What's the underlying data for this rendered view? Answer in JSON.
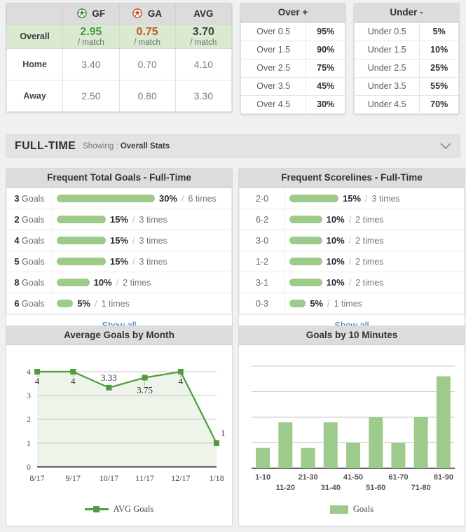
{
  "goals_table": {
    "columns": [
      {
        "label": "",
        "icon": ""
      },
      {
        "label": "GF",
        "icon": "football-green-icon"
      },
      {
        "label": "GA",
        "icon": "football-red-icon"
      },
      {
        "label": "AVG",
        "icon": ""
      }
    ],
    "rows": [
      {
        "label": "Overall",
        "gf": "2.95",
        "gf_sub": "/ match",
        "ga": "0.75",
        "ga_sub": "/ match",
        "avg": "3.70",
        "avg_sub": "/ match"
      },
      {
        "label": "Home",
        "gf": "3.40",
        "ga": "0.70",
        "avg": "4.10"
      },
      {
        "label": "Away",
        "gf": "2.50",
        "ga": "0.80",
        "avg": "3.30"
      }
    ]
  },
  "over": {
    "title": "Over +",
    "rows": [
      {
        "label": "Over 0.5",
        "pct": "95%"
      },
      {
        "label": "Over 1.5",
        "pct": "90%"
      },
      {
        "label": "Over 2.5",
        "pct": "75%"
      },
      {
        "label": "Over 3.5",
        "pct": "45%"
      },
      {
        "label": "Over 4.5",
        "pct": "30%"
      }
    ]
  },
  "under": {
    "title": "Under -",
    "rows": [
      {
        "label": "Under 0.5",
        "pct": "5%"
      },
      {
        "label": "Under 1.5",
        "pct": "10%"
      },
      {
        "label": "Under 2.5",
        "pct": "25%"
      },
      {
        "label": "Under 3.5",
        "pct": "55%"
      },
      {
        "label": "Under 4.5",
        "pct": "70%"
      }
    ]
  },
  "fulltime_bar": {
    "title": "FULL-TIME",
    "showing_label": "Showing :",
    "showing_value": "Overall Stats",
    "chevron": "chevron-down-icon"
  },
  "frequent_total_goals": {
    "title": "Frequent Total Goals - Full-Time",
    "show_all": "Show all",
    "rows": [
      {
        "key_num": "3",
        "key_word": "Goals",
        "pct": "30%",
        "pct_num": 30,
        "times": "6 times"
      },
      {
        "key_num": "2",
        "key_word": "Goals",
        "pct": "15%",
        "pct_num": 15,
        "times": "3 times"
      },
      {
        "key_num": "4",
        "key_word": "Goals",
        "pct": "15%",
        "pct_num": 15,
        "times": "3 times"
      },
      {
        "key_num": "5",
        "key_word": "Goals",
        "pct": "15%",
        "pct_num": 15,
        "times": "3 times"
      },
      {
        "key_num": "8",
        "key_word": "Goals",
        "pct": "10%",
        "pct_num": 10,
        "times": "2 times"
      },
      {
        "key_num": "6",
        "key_word": "Goals",
        "pct": "5%",
        "pct_num": 5,
        "times": "1 times"
      }
    ]
  },
  "frequent_scorelines": {
    "title": "Frequent Scorelines - Full-Time",
    "show_all": "Show all",
    "rows": [
      {
        "key": "2-0",
        "pct": "15%",
        "pct_num": 15,
        "times": "3 times"
      },
      {
        "key": "6-2",
        "pct": "10%",
        "pct_num": 10,
        "times": "2 times"
      },
      {
        "key": "3-0",
        "pct": "10%",
        "pct_num": 10,
        "times": "2 times"
      },
      {
        "key": "1-2",
        "pct": "10%",
        "pct_num": 10,
        "times": "2 times"
      },
      {
        "key": "3-1",
        "pct": "10%",
        "pct_num": 10,
        "times": "2 times"
      },
      {
        "key": "0-3",
        "pct": "5%",
        "pct_num": 5,
        "times": "1 times"
      }
    ]
  },
  "colors": {
    "bar_green": "#9ccb8b",
    "line_green": "#4e9c3c",
    "area_green": "#eef4e9",
    "link_blue": "#3071b9",
    "gf_green": "#4f9a43",
    "ga_red": "#c0562b",
    "header_grey": "#dcdcdc",
    "overall_row": "#d9ead1"
  },
  "chart_data": [
    {
      "type": "line",
      "title": "Average Goals by Month",
      "categories": [
        "8/17",
        "9/17",
        "10/17",
        "11/17",
        "12/17",
        "1/18"
      ],
      "values": [
        4,
        4,
        3.33,
        3.75,
        4,
        1
      ],
      "point_labels": [
        "4",
        "4",
        "3.33",
        "3.75",
        "4",
        "1"
      ],
      "series": [
        {
          "name": "AVG Goals",
          "values": [
            4,
            4,
            3.33,
            3.75,
            4,
            1
          ]
        }
      ],
      "legend": [
        "AVG Goals"
      ],
      "legend_position": "bottom",
      "xlabel": "",
      "ylabel": "",
      "ylim": [
        0,
        4
      ],
      "yticks": [
        0,
        1,
        2,
        3,
        4
      ],
      "ytick_labels": [
        "0",
        "1",
        "2",
        "3",
        "4"
      ],
      "grid": true
    },
    {
      "type": "bar",
      "title": "Goals by 10 Minutes",
      "categories": [
        "1-10",
        "11-20",
        "21-30",
        "31-40",
        "41-50",
        "51-60",
        "61-70",
        "71-80",
        "81-90"
      ],
      "values": [
        0.8,
        1.8,
        0.8,
        1.8,
        1.0,
        2.0,
        1.0,
        2.0,
        3.6
      ],
      "series": [
        {
          "name": "Goals",
          "values": [
            0.8,
            1.8,
            0.8,
            1.8,
            1.0,
            2.0,
            1.0,
            2.0,
            3.6
          ]
        }
      ],
      "legend": [
        "Goals"
      ],
      "legend_position": "bottom",
      "xlabel": "",
      "ylabel": "",
      "ylim": [
        0,
        4
      ],
      "yticks": [
        0,
        1,
        2,
        3,
        4
      ],
      "ytick_labels": [
        "",
        "",
        "",
        "",
        ""
      ],
      "grid": true
    }
  ]
}
